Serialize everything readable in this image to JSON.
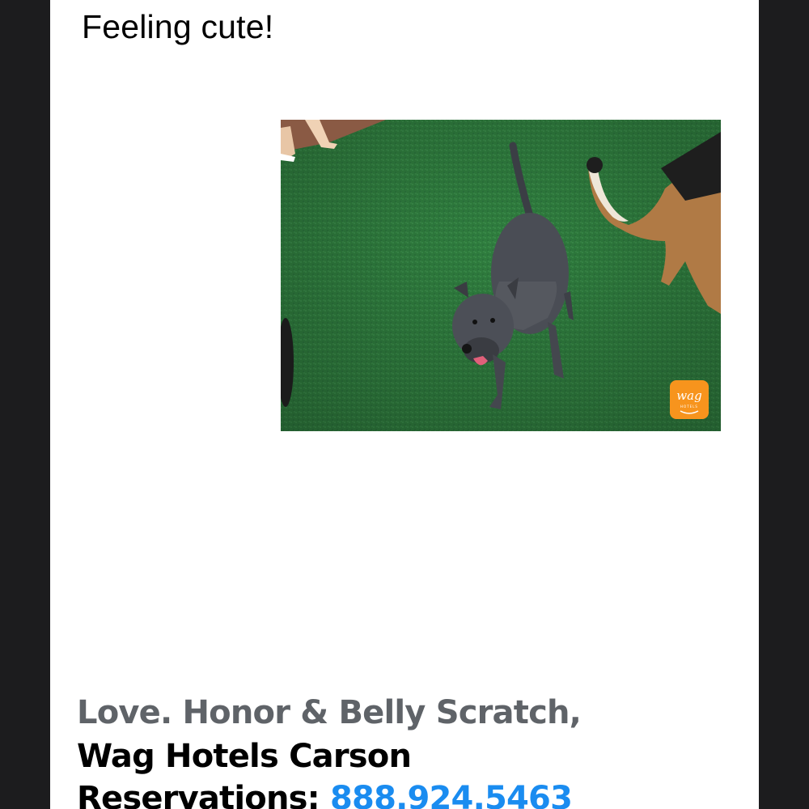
{
  "message": {
    "caption": "Feeling cute!",
    "photo": {
      "subject": "brindle-dog-on-artificial-turf",
      "badge_text": "wag",
      "badge_subtext": "HOTELS",
      "badge_color": "#f7941d",
      "turf_color": "#2f7d3e"
    }
  },
  "signature": {
    "line1": "Love. Honor & Belly Scratch,",
    "line2": "Wag Hotels Carson",
    "reservations_label": "Reservations:",
    "phone": "888.924.5463"
  },
  "colors": {
    "frame": "#1c1c1e",
    "page": "#ffffff",
    "muted_text": "#5f6368",
    "link": "#1a8cf0"
  }
}
